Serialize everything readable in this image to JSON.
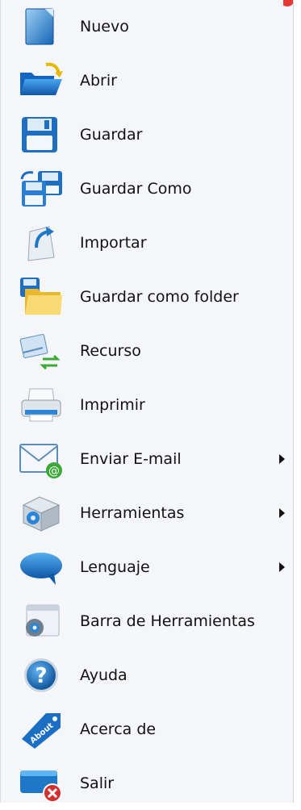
{
  "menu": {
    "items": [
      {
        "label": "Nuevo",
        "icon": "new-document-icon",
        "submenu": false
      },
      {
        "label": "Abrir",
        "icon": "open-folder-icon",
        "submenu": false
      },
      {
        "label": "Guardar",
        "icon": "floppy-disk-icon",
        "submenu": false
      },
      {
        "label": "Guardar Como",
        "icon": "save-as-icon",
        "submenu": false
      },
      {
        "label": "Importar",
        "icon": "import-icon",
        "submenu": false
      },
      {
        "label": "Guardar como folder",
        "icon": "save-to-folder-icon",
        "submenu": false
      },
      {
        "label": "Recurso",
        "icon": "resource-icon",
        "submenu": false
      },
      {
        "label": "Imprimir",
        "icon": "printer-icon",
        "submenu": false
      },
      {
        "label": "Enviar E-mail",
        "icon": "email-icon",
        "submenu": true
      },
      {
        "label": "Herramientas",
        "icon": "tools-icon",
        "submenu": true
      },
      {
        "label": "Lenguaje",
        "icon": "speech-bubble-icon",
        "submenu": true
      },
      {
        "label": "Barra de Herramientas",
        "icon": "toolbar-settings-icon",
        "submenu": false
      },
      {
        "label": "Ayuda",
        "icon": "help-icon",
        "submenu": false
      },
      {
        "label": "Acerca de",
        "icon": "about-tag-icon",
        "submenu": false
      },
      {
        "label": "Salir",
        "icon": "exit-icon",
        "submenu": false
      }
    ],
    "icon_badge_text": "About"
  },
  "colors": {
    "menu_background": "#f4f6f9",
    "text": "#111111",
    "accent_blue": "#1f77c8",
    "exit_red": "#d32f2f",
    "email_green": "#3aa935"
  }
}
